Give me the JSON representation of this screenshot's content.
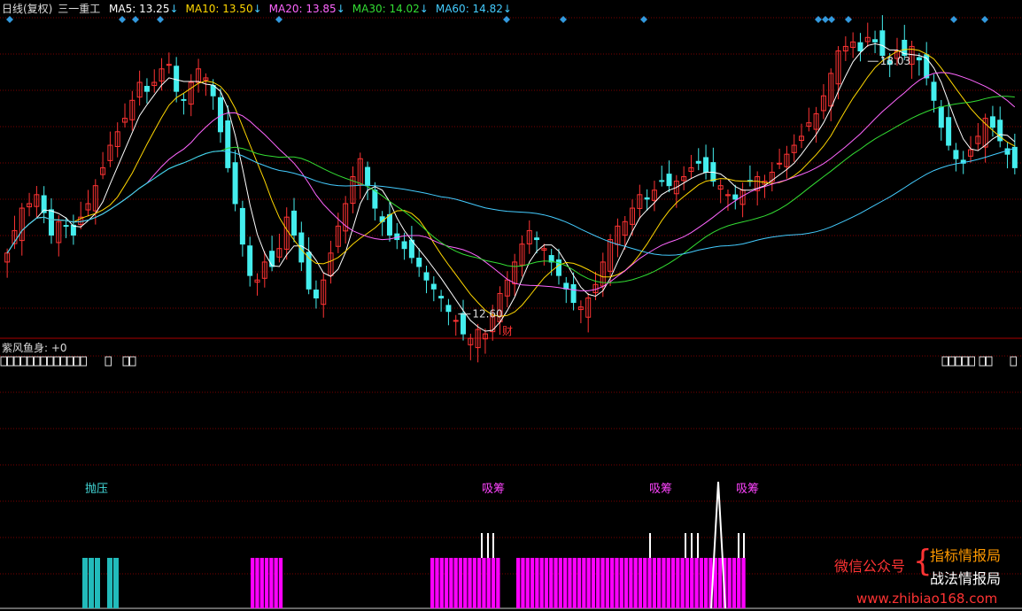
{
  "header": {
    "period": "日线(复权)",
    "stock": "三一重工",
    "ma": [
      {
        "label": "MA5:",
        "value": "13.25",
        "arrow": "↓",
        "color": "#ffffff"
      },
      {
        "label": "MA10:",
        "value": "13.50",
        "arrow": "↓",
        "color": "#ffd700"
      },
      {
        "label": "MA20:",
        "value": "13.85",
        "arrow": "↓",
        "color": "#ff66ff"
      },
      {
        "label": "MA30:",
        "value": "14.02",
        "arrow": "↓",
        "color": "#33dd33"
      },
      {
        "label": "MA60:",
        "value": "14.82",
        "arrow": "↓",
        "color": "#44ccff"
      }
    ]
  },
  "price_labels": {
    "high": "18.03",
    "low": "12.60",
    "cai": "财"
  },
  "indicator": {
    "name": "紫风鱼身:",
    "value": "+0"
  },
  "signals": {
    "paoya": "抛压",
    "xichou": "吸筹"
  },
  "watermark": {
    "wechat": "微信公众号",
    "brace": "{",
    "name1": "指标情报局",
    "name2": "战法情报局",
    "url": "www.zhibiao168.com"
  },
  "colors": {
    "up": "#ff3333",
    "down": "#44eeee",
    "ma5": "#ffffff",
    "ma10": "#ffd700",
    "ma20": "#ff66ff",
    "ma30": "#33dd33",
    "ma60": "#44ccff",
    "grid": "#7a0000",
    "cyan_bar": "#22bbbb",
    "magenta_bar": "#ff00ff",
    "diamond": "#3399dd"
  },
  "chart_data": {
    "type": "candlestick",
    "price_range": [
      12.1,
      19.0
    ],
    "close": [
      13.8,
      14.3,
      14.8,
      14.9,
      15.1,
      14.7,
      14.2,
      14.5,
      14.4,
      14.2,
      14.6,
      14.9,
      15.3,
      15.7,
      16.2,
      16.5,
      16.8,
      17.2,
      17.6,
      17.4,
      17.6,
      17.9,
      18.0,
      17.4,
      17.2,
      17.6,
      17.9,
      17.7,
      17.3,
      16.5,
      15.7,
      14.9,
      14.0,
      13.3,
      13.2,
      13.6,
      13.5,
      13.9,
      14.6,
      14.2,
      13.6,
      13.0,
      12.8,
      13.2,
      13.8,
      14.4,
      14.9,
      15.5,
      15.9,
      15.3,
      14.8,
      14.5,
      14.2,
      14.1,
      13.9,
      13.7,
      13.5,
      13.2,
      13.0,
      12.8,
      12.5,
      12.3,
      12.0,
      11.9,
      12.1,
      12.0,
      12.4,
      12.9,
      13.2,
      13.6,
      14.0,
      14.3,
      14.1,
      13.9,
      13.6,
      13.3,
      13.0,
      12.7,
      12.6,
      12.8,
      13.1,
      13.6,
      14.1,
      14.4,
      14.5,
      14.8,
      15.1,
      15.0,
      15.2,
      15.4,
      15.3,
      15.4,
      15.5,
      15.7,
      15.8,
      15.6,
      15.4,
      15.3,
      15.1,
      15.0,
      15.2,
      15.4,
      15.5,
      15.4,
      15.6,
      15.8,
      16.0,
      16.2,
      16.4,
      16.7,
      16.9,
      17.3,
      17.8,
      18.3,
      18.4,
      18.5,
      18.3,
      18.6,
      18.5,
      18.2,
      18.0,
      18.3,
      18.2,
      18.4,
      18.1,
      17.7,
      17.2,
      16.6,
      16.2,
      15.9,
      15.8,
      16.1,
      16.4,
      16.8,
      16.6,
      16.3,
      16.0,
      15.7
    ],
    "ma5_last": 13.25,
    "ma10_last": 13.5,
    "ma20_last": 13.85,
    "ma30_last": 14.02,
    "ma60_last": 14.82,
    "high_mark": 18.03,
    "low_mark": 12.6,
    "indicator_value": 0,
    "cyan_bars_x": [
      96,
      103,
      110,
      124,
      131
    ],
    "magenta_ranges": [
      [
        283,
        316
      ],
      [
        486,
        561
      ],
      [
        583,
        840
      ]
    ],
    "white_ticks_x": [
      544,
      551,
      557,
      734,
      774,
      781,
      788,
      834,
      840
    ],
    "diamonds_x": [
      11,
      138,
      153,
      181,
      315,
      572,
      636,
      727,
      924,
      932,
      939,
      958,
      1077,
      1112
    ]
  }
}
